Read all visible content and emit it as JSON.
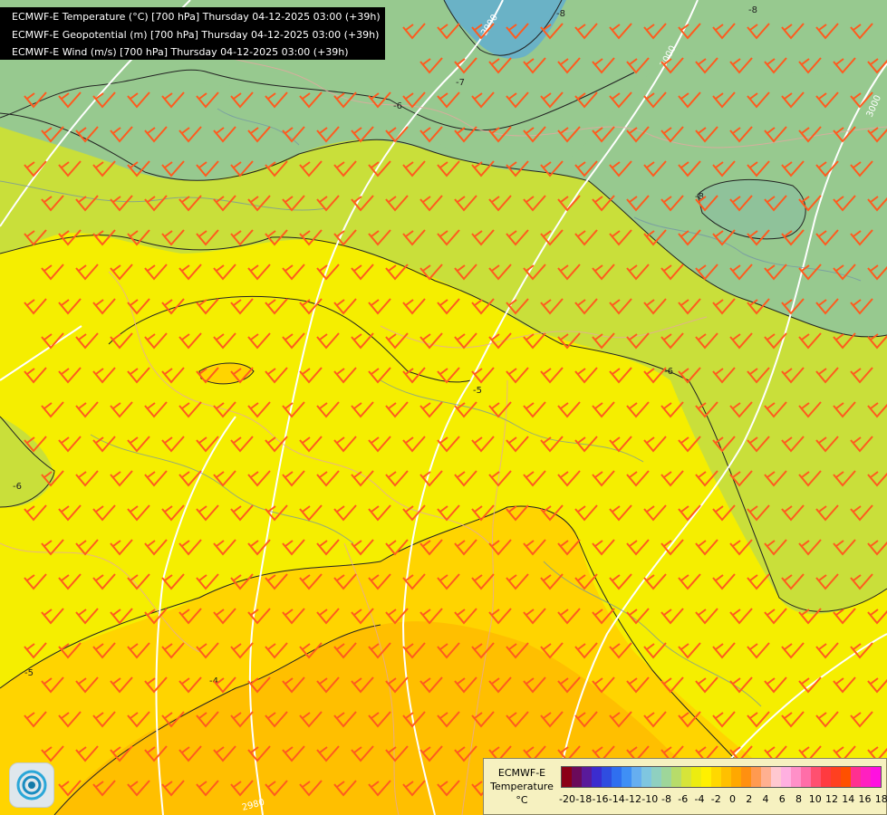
{
  "titles": [
    "ECMWF-E Temperature (°C) [700 hPa] Thursday 04-12-2025 03:00 (+39h)",
    "ECMWF-E Geopotential (m) [700 hPa] Thursday 04-12-2025 03:00 (+39h)",
    "ECMWF-E Wind (m/s) [700 hPa] Thursday 04-12-2025 03:00 (+39h)"
  ],
  "legend": {
    "model": "ECMWF-E",
    "variable": "Temperature",
    "unit": "°C",
    "ticks": [
      "-20",
      "-18",
      "-16",
      "-14",
      "-12",
      "-10",
      "-8",
      "-6",
      "-4",
      "-2",
      "0",
      "2",
      "4",
      "6",
      "8",
      "10",
      "12",
      "14",
      "16",
      "18"
    ],
    "colors": [
      "#8b0016",
      "#6b0a5a",
      "#5a1a9a",
      "#3b2ccf",
      "#2f4de0",
      "#2f6ff0",
      "#3f8ff5",
      "#66aef0",
      "#7fc6e0",
      "#8fd0c0",
      "#9ed69a",
      "#b7dc6a",
      "#d6e43a",
      "#ecec10",
      "#fff000",
      "#ffd800",
      "#ffc000",
      "#ffa800",
      "#ff9010",
      "#ff9a50",
      "#ffb090",
      "#ffc8d0",
      "#ffb0e0",
      "#ff90c8",
      "#ff6ea8",
      "#ff5070",
      "#ff3a40",
      "#ff4020",
      "#ff5000",
      "#ff3090",
      "#ff20c0",
      "#ff10e0"
    ]
  },
  "isotherm_labels": [
    "-8",
    "-8",
    "-8",
    "-7",
    "-6",
    "-6",
    "-6",
    "-5",
    "-5",
    "-4"
  ],
  "geopotential_labels": [
    "2990",
    "3000",
    "3000",
    "2980"
  ],
  "colors": {
    "temp_m8": "#6ab2c6",
    "temp_m7": "#97c98f",
    "temp_m6": "#c9df3a",
    "temp_m5": "#f5ee00",
    "temp_m4": "#ffd400",
    "temp_m3": "#ffbf00",
    "wind_barb": "#ff5a1e",
    "geopotential_contour": "#ffffff",
    "isotherm": "#222222"
  }
}
